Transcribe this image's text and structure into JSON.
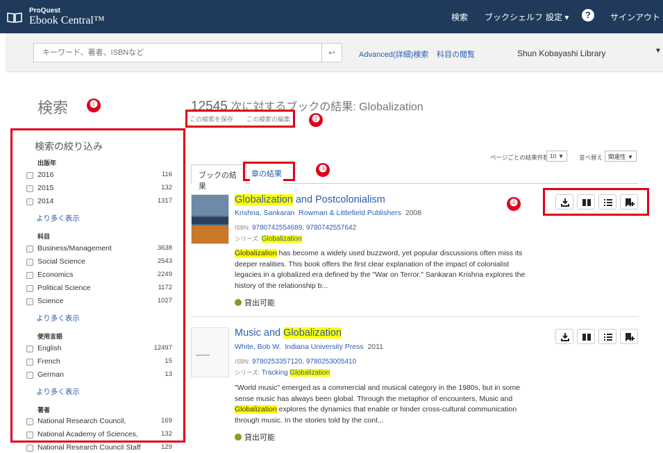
{
  "header": {
    "brand_small": "ProQuest",
    "brand": "Ebook Central™",
    "nav": {
      "search": "検索",
      "bookshelf": "ブックシェルフ",
      "settings": "設定 ▾",
      "help": "?",
      "signout": "サインアウト"
    }
  },
  "search": {
    "placeholder": "キーワード、著者、ISBNなど",
    "go_icon": "↩",
    "advanced_label": "Advanced(詳細)検索",
    "browse_label": "科目の閲覧",
    "library_name": "Shun Kobayashi Library",
    "library_caret": "▼"
  },
  "page": {
    "heading": "検索",
    "results_count": "12545",
    "results_text": " 次に対するブックの結果: Globalization",
    "save_search": "この検索を保存",
    "edit_search": "この検索の編集",
    "per_page_label": "ページごとの結果件数",
    "per_page_value": "10 ▼",
    "sort_label": "並べ替え",
    "sort_value": "関連性 ▼"
  },
  "markers": [
    "❶",
    "❷",
    "❸",
    "❹"
  ],
  "tabs": {
    "books": "ブックの結果",
    "chapters": "章の結果"
  },
  "filters": {
    "title": "検索の絞り込み",
    "more_label": "より多く表示",
    "pub_year": {
      "heading": "出版年",
      "items": [
        {
          "label": "2016",
          "count": "116"
        },
        {
          "label": "2015",
          "count": "132"
        },
        {
          "label": "2014",
          "count": "1317"
        }
      ]
    },
    "subject": {
      "heading": "科目",
      "items": [
        {
          "label": "Business/Management",
          "count": "3638"
        },
        {
          "label": "Social Science",
          "count": "2543"
        },
        {
          "label": "Economics",
          "count": "2249"
        },
        {
          "label": "Political Science",
          "count": "1172"
        },
        {
          "label": "Science",
          "count": "1027"
        }
      ]
    },
    "language": {
      "heading": "使用言語",
      "items": [
        {
          "label": "English",
          "count": "12497"
        },
        {
          "label": "French",
          "count": "15"
        },
        {
          "label": "German",
          "count": "13"
        }
      ]
    },
    "author": {
      "heading": "著者",
      "items": [
        {
          "label": "National Research Council,",
          "count": "169"
        },
        {
          "label": "National Academy of Sciences,",
          "count": "132"
        },
        {
          "label": "National Research Council Staff",
          "count": "129"
        }
      ]
    }
  },
  "results": [
    {
      "title_hl": "Globalization",
      "title_rest": " and Postcolonialism",
      "authors": "Krishna, Sankaran",
      "publisher": "Rowman & Littlefield Publishers",
      "year": "2008",
      "isbn_label": "ISBN:",
      "isbn": "9780742554689, 9780742557642",
      "series_label": "シリーズ:",
      "series_pre": "",
      "series_hl": "Globalization",
      "desc_hl": "Globalization",
      "desc_rest": " has become a widely used buzzword, yet popular discussions often miss its deeper realities. This book offers the first clear explanation of the impact of colonialist legacies in a globalized era defined by the \"War on Terror.\" Sankaran Krishna explores the history of the relationship b...",
      "availability": "貸出可能"
    },
    {
      "title_pre": "Music and ",
      "title_hl": "Globalization",
      "authors": "White, Bob W.",
      "publisher": "Indiana University Press",
      "year": "2011",
      "isbn_label": "ISBN:",
      "isbn": "9780253357120, 9780253005410",
      "series_label": "シリーズ:",
      "series_pre": "Tracking ",
      "series_hl": "Globalization",
      "desc_pre": "\"World music\" emerged as a commercial and musical category in the 1980s, but in some sense music has always been global. Through the metaphor of encounters, Music and ",
      "desc_hl": "Globalization",
      "desc_rest": " explores the dynamics that enable or hinder cross-cultural communication through music. In the stories told by the cont...",
      "availability": "貸出可能"
    }
  ],
  "colors": {
    "header_bg": "#1f3a5a",
    "annotation_red": "#e0001b",
    "link_blue": "#2a5db0",
    "highlight": "#ffff00",
    "available_green": "#8a9a1c"
  }
}
